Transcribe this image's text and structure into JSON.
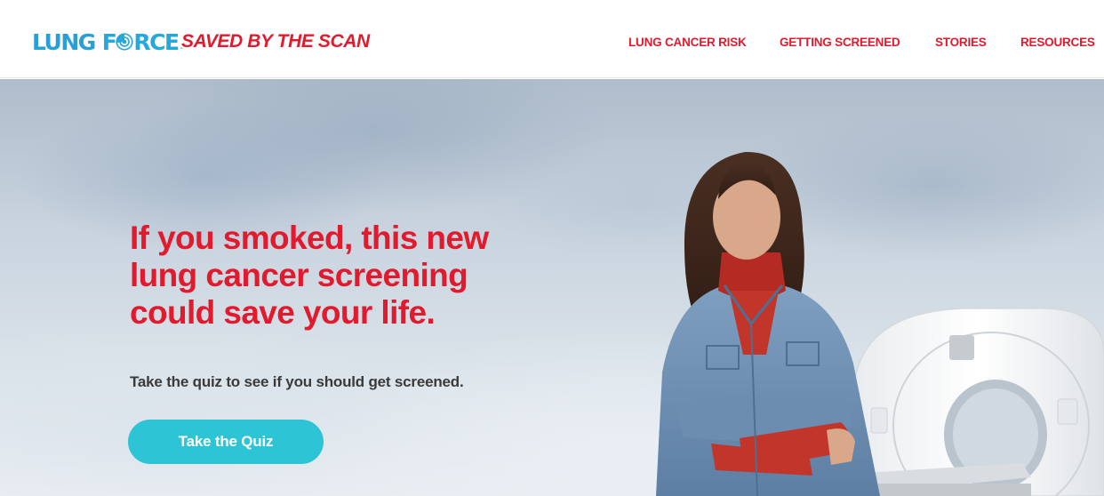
{
  "header": {
    "logo": {
      "part1": "LUNG",
      "part2": "RCE",
      "trademark": "."
    },
    "tagline": "SAVED BY THE SCAN",
    "nav": [
      {
        "label": "LUNG CANCER RISK"
      },
      {
        "label": "GETTING SCREENED"
      },
      {
        "label": "STORIES"
      },
      {
        "label": "RESOURCES"
      }
    ]
  },
  "hero": {
    "title": "If you smoked, this new lung cancer screening could save your life.",
    "subtitle": "Take the quiz to see if you should get screened.",
    "cta_label": "Take the Quiz"
  },
  "colors": {
    "brand_red": "#e11a2d",
    "brand_blue": "#2a9fd6",
    "cta_teal": "#2dc5d6",
    "text_dark": "#3a3a3a"
  },
  "icons": {
    "logo_swirl": "swirl-o-icon"
  }
}
